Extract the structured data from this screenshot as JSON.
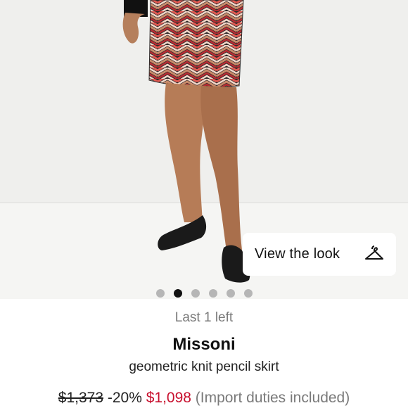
{
  "product_image": {
    "alt": "Model wearing geometric knit pencil skirt"
  },
  "view_look": {
    "label": "View the look",
    "icon": "hanger-icon"
  },
  "carousel": {
    "total": 6,
    "active_index": 1
  },
  "product": {
    "stock": "Last 1 left",
    "brand": "Missoni",
    "name": "geometric knit pencil skirt"
  },
  "price": {
    "original": "$1,373",
    "discount": "-20%",
    "sale": "$1,098",
    "duties_note": "(Import duties included)"
  },
  "colors": {
    "sale_price": "#c8102e",
    "active_dot": "#111111",
    "inactive_dot": "#b6b6b6"
  }
}
